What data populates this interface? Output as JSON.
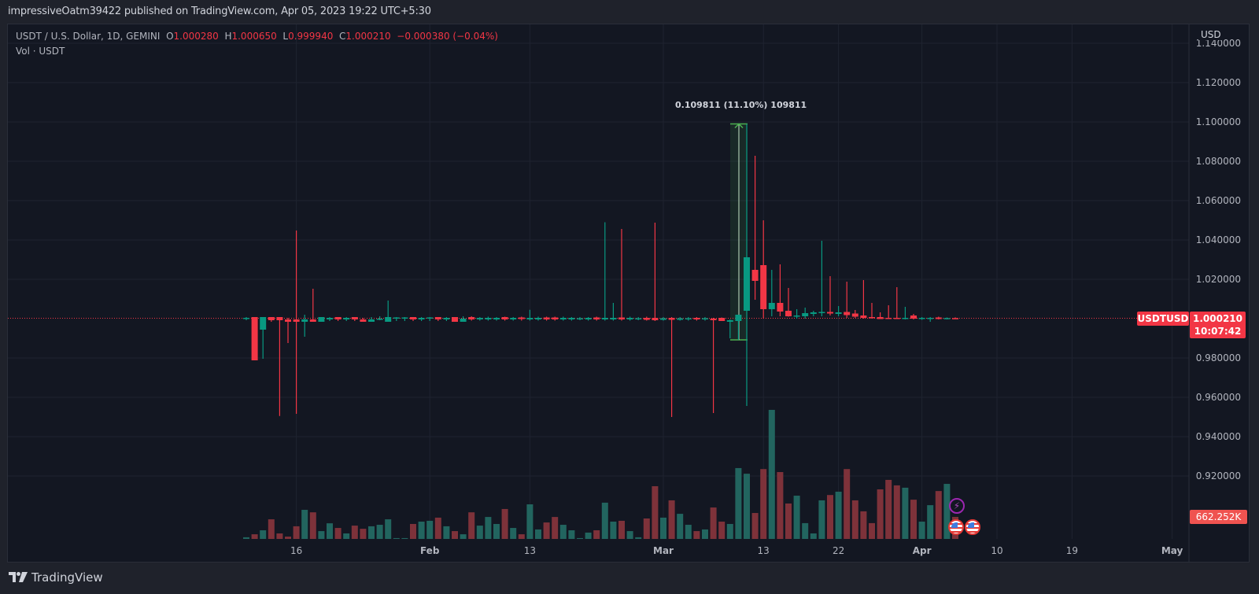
{
  "header": {
    "published": "impressiveOatm39422 published on TradingView.com, Apr 05, 2023 19:22 UTC+5:30"
  },
  "legend": {
    "symbol": "USDT / U.S. Dollar, 1D, GEMINI",
    "o_label": "O",
    "o": "1.000280",
    "h_label": "H",
    "h": "1.000650",
    "l_label": "L",
    "l": "0.999940",
    "c_label": "C",
    "c": "1.000210",
    "change": "−0.000380 (−0.04%)",
    "volume": "Vol · USDT"
  },
  "price_axis": {
    "currency": "USD",
    "symbol_badge": "USDTUSD",
    "last_price": "1.000210",
    "countdown": "10:07:42",
    "volume_badge": "662.252K"
  },
  "measurement": {
    "label": "0.109811 (11.10%) 109811"
  },
  "branding": {
    "logo_text": "TradingView"
  },
  "colors": {
    "up": "#089981",
    "down": "#f23645",
    "vol_up": "#22655f",
    "vol_down": "#7e323a",
    "grid": "#1f2330"
  },
  "chart_data": {
    "type": "candlestick",
    "title": "USDT / U.S. Dollar, 1D, GEMINI",
    "start_date": "2023-01-10",
    "interval": "1D",
    "ylim": [
      0.88,
      1.145
    ],
    "last_price": 1.00021,
    "price_ticks": [
      {
        "value": 1.14,
        "label": "1.140000"
      },
      {
        "value": 1.12,
        "label": "1.120000"
      },
      {
        "value": 1.1,
        "label": "1.100000"
      },
      {
        "value": 1.08,
        "label": "1.080000"
      },
      {
        "value": 1.06,
        "label": "1.060000"
      },
      {
        "value": 1.04,
        "label": "1.040000"
      },
      {
        "value": 1.02,
        "label": "1.020000"
      },
      {
        "value": 0.98,
        "label": "0.980000"
      },
      {
        "value": 0.96,
        "label": "0.960000"
      },
      {
        "value": 0.94,
        "label": "0.940000"
      },
      {
        "value": 0.92,
        "label": "0.920000"
      }
    ],
    "x_ticks": [
      {
        "day": 6,
        "label": "16",
        "bold": false
      },
      {
        "day": 22,
        "label": "Feb",
        "bold": true
      },
      {
        "day": 34,
        "label": "13",
        "bold": false
      },
      {
        "day": 50,
        "label": "Mar",
        "bold": true
      },
      {
        "day": 62,
        "label": "13",
        "bold": false
      },
      {
        "day": 71,
        "label": "22",
        "bold": false
      },
      {
        "day": 81,
        "label": "Apr",
        "bold": true
      },
      {
        "day": 90,
        "label": "10",
        "bold": false
      },
      {
        "day": 99,
        "label": "19",
        "bold": false
      },
      {
        "day": 111,
        "label": "May",
        "bold": true
      }
    ],
    "ohlc": [
      [
        1.0002,
        1.0008,
        0.9992,
        1.0004
      ],
      [
        1.0008,
        1.0008,
        0.9788,
        0.9788
      ],
      [
        0.9944,
        1.0008,
        0.9796,
        1.0008
      ],
      [
        1.0008,
        1.0008,
        0.9984,
        0.9992
      ],
      [
        1.0008,
        1.0008,
        0.9505,
        0.9992
      ],
      [
        0.9996,
        1.0004,
        0.9876,
        0.9984
      ],
      [
        0.9996,
        1.0448,
        0.9516,
        0.9984
      ],
      [
        0.9984,
        1.002,
        0.9908,
        0.9996
      ],
      [
        0.9996,
        1.0152,
        0.9984,
        0.9984
      ],
      [
        0.9984,
        1.0008,
        0.9984,
        1.0008
      ],
      [
        0.9996,
        1.0008,
        0.9988,
        1.0004
      ],
      [
        1.0008,
        1.0008,
        0.9988,
        0.9996
      ],
      [
        0.9996,
        1.0008,
        0.9988,
        1.0004
      ],
      [
        1.0008,
        1.0008,
        0.9988,
        0.9996
      ],
      [
        0.9996,
        1.0004,
        0.9984,
        0.9984
      ],
      [
        0.9984,
        1.0008,
        0.9984,
        0.9996
      ],
      [
        0.9996,
        1.0012,
        0.9992,
        1.0
      ],
      [
        0.9984,
        1.0092,
        0.9984,
        1.0008
      ],
      [
        1.0004,
        1.0008,
        0.9988,
        1.0006
      ],
      [
        1.0004,
        1.0008,
        0.9988,
        1.0006
      ],
      [
        1.0008,
        1.0008,
        0.9988,
        0.9996
      ],
      [
        0.9996,
        1.0008,
        0.9988,
        1.0004
      ],
      [
        1.0004,
        1.0008,
        0.9988,
        1.0006
      ],
      [
        1.0008,
        1.0008,
        0.9988,
        0.9996
      ],
      [
        0.9996,
        1.0008,
        0.9988,
        1.0004
      ],
      [
        1.0008,
        1.0008,
        0.9984,
        0.9984
      ],
      [
        0.9984,
        1.0012,
        0.9984,
        1.0
      ],
      [
        1.0008,
        1.0012,
        0.999,
        0.9996
      ],
      [
        0.9996,
        1.0008,
        0.999,
        1.0004
      ],
      [
        0.9996,
        1.001,
        0.999,
        1.0004
      ],
      [
        0.9996,
        1.0008,
        0.999,
        1.0004
      ],
      [
        1.0008,
        1.001,
        0.999,
        0.9996
      ],
      [
        0.9996,
        1.0008,
        0.999,
        1.0004
      ],
      [
        1.0006,
        1.001,
        0.999,
        0.9998
      ],
      [
        0.9996,
        1.0045,
        0.999,
        1.0004
      ],
      [
        0.9996,
        1.001,
        0.999,
        1.0004
      ],
      [
        1.0006,
        1.001,
        0.999,
        0.9996
      ],
      [
        1.0006,
        1.001,
        0.999,
        0.9996
      ],
      [
        0.9996,
        1.001,
        0.999,
        1.0004
      ],
      [
        0.9996,
        1.0008,
        0.999,
        1.0004
      ],
      [
        0.9998,
        1.0008,
        0.9992,
        1.0002
      ],
      [
        0.9996,
        1.0008,
        0.999,
        1.0004
      ],
      [
        1.0006,
        1.001,
        0.999,
        0.9996
      ],
      [
        0.9996,
        1.049,
        0.999,
        1.0004
      ],
      [
        0.9996,
        1.008,
        0.999,
        1.0004
      ],
      [
        1.0006,
        1.0456,
        0.999,
        0.9996
      ],
      [
        0.9996,
        1.001,
        0.999,
        1.0004
      ],
      [
        0.9998,
        1.0008,
        0.9992,
        1.0002
      ],
      [
        1.0004,
        1.001,
        0.999,
        0.9994
      ],
      [
        1.0004,
        1.0488,
        0.9988,
        0.9992
      ],
      [
        0.9994,
        1.0008,
        0.999,
        1.0002
      ],
      [
        1.0004,
        1.0008,
        0.95,
        0.9994
      ],
      [
        0.9994,
        1.0008,
        0.999,
        1.0002
      ],
      [
        0.9996,
        1.0008,
        0.999,
        1.0002
      ],
      [
        1.0004,
        1.0008,
        0.999,
        0.9996
      ],
      [
        0.9996,
        1.0008,
        0.999,
        1.0002
      ],
      [
        1.0,
        1.0004,
        0.952,
        0.9992
      ],
      [
        1.0004,
        1.0006,
        0.9988,
        0.9988
      ],
      [
        0.9984,
        0.9996,
        0.99,
        0.9992
      ],
      [
        0.9988,
        1.002,
        0.9892,
        1.002
      ],
      [
        1.004,
        1.099,
        0.9556,
        1.0312
      ],
      [
        1.0248,
        1.0828,
        1.0096,
        1.0192
      ],
      [
        1.0272,
        1.05,
        1.0,
        1.0048
      ],
      [
        1.0048,
        1.0248,
        1.0012,
        1.008
      ],
      [
        1.008,
        1.0276,
        1.0012,
        1.0036
      ],
      [
        1.004,
        1.0156,
        1.001,
        1.0012
      ],
      [
        1.001,
        1.0048,
        1.0,
        1.0016
      ],
      [
        1.0012,
        1.0056,
        1.0,
        1.0028
      ],
      [
        1.0024,
        1.004,
        1.0012,
        1.0032
      ],
      [
        1.0028,
        1.0396,
        1.0012,
        1.0034
      ],
      [
        1.0034,
        1.0216,
        1.0016,
        1.0026
      ],
      [
        1.0024,
        1.0064,
        1.0012,
        1.0032
      ],
      [
        1.0034,
        1.0188,
        1.0004,
        1.0018
      ],
      [
        1.0026,
        1.0044,
        1.0004,
        1.001
      ],
      [
        1.0016,
        1.0196,
        1.0,
        1.0004
      ],
      [
        1.0008,
        1.008,
        1.0,
        1.0002
      ],
      [
        1.0008,
        1.0032,
        0.9998,
        0.9998
      ],
      [
        1.0004,
        1.0068,
        0.9998,
        0.9998
      ],
      [
        1.0004,
        1.016,
        0.9998,
        0.9998
      ],
      [
        0.9998,
        1.006,
        0.9996,
        1.0004
      ],
      [
        1.0016,
        1.0024,
        0.9996,
        1.0
      ],
      [
        0.9998,
        1.0008,
        0.9994,
        1.0004
      ],
      [
        0.9998,
        1.0008,
        0.9984,
        1.0004
      ],
      [
        1.0006,
        1.001,
        0.9996,
        0.9998
      ],
      [
        0.9998,
        1.0006,
        0.9996,
        1.0003
      ],
      [
        1.00028,
        1.00065,
        0.99994,
        1.00021
      ]
    ],
    "volume_k": [
      50,
      140,
      260,
      590,
      165,
      70,
      380,
      875,
      800,
      235,
      470,
      330,
      165,
      400,
      305,
      380,
      425,
      590,
      25,
      25,
      450,
      520,
      545,
      640,
      380,
      235,
      140,
      800,
      400,
      660,
      450,
      900,
      330,
      140,
      1040,
      285,
      495,
      660,
      425,
      260,
      25,
      190,
      260,
      1090,
      520,
      545,
      235,
      50,
      615,
      1585,
      640,
      1160,
      755,
      425,
      235,
      285,
      945,
      520,
      450,
      2130,
      1960,
      780,
      2100,
      3880,
      2010,
      1065,
      1300,
      475,
      165,
      1160,
      1320,
      1420,
      2100,
      1160,
      830,
      475,
      1490,
      1775,
      1610,
      1540,
      1180,
      520,
      1015,
      1440,
      1655,
      662.252
    ],
    "measurement": {
      "from": 0.98919,
      "to": 1.099,
      "change": 0.109811,
      "percent": 11.1,
      "ticks": 109811
    }
  }
}
